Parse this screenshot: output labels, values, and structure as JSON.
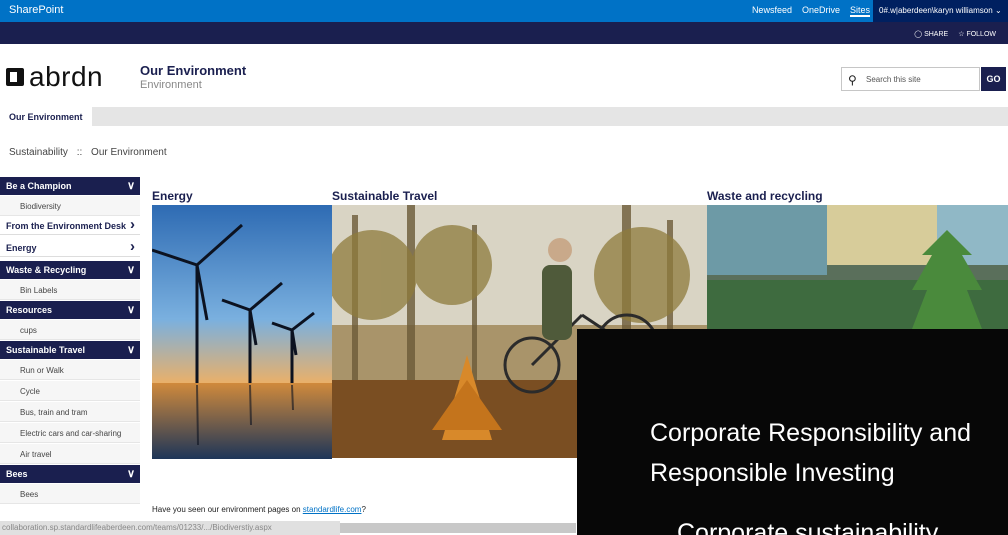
{
  "suite": {
    "brand": "SharePoint",
    "links": [
      "Newsfeed",
      "OneDrive",
      "Sites"
    ],
    "user": "0#.w|aberdeen\\karyn williamson"
  },
  "actions": {
    "share": "SHARE",
    "follow": "FOLLOW"
  },
  "header": {
    "logo_text": "abrdn",
    "site_title": "Our Environment",
    "site_subtitle": "Environment"
  },
  "search": {
    "placeholder": "Search this site",
    "go_label": "GO"
  },
  "topnav": {
    "tab": "Our Environment"
  },
  "breadcrumb": {
    "root": "Sustainability",
    "sep": "::",
    "current": "Our Environment"
  },
  "sidebar": {
    "items": [
      {
        "label": "Be a Champion",
        "type": "head",
        "chevron": "down"
      },
      {
        "label": "Biodiversity",
        "type": "sub"
      },
      {
        "label": "From the Environment Desk",
        "type": "plain",
        "chevron": "right"
      },
      {
        "label": "Energy",
        "type": "plain",
        "chevron": "right"
      },
      {
        "label": "Waste & Recycling",
        "type": "head",
        "chevron": "down"
      },
      {
        "label": "Bin Labels",
        "type": "sub"
      },
      {
        "label": "Resources",
        "type": "head",
        "chevron": "down"
      },
      {
        "label": "cups",
        "type": "sub"
      },
      {
        "label": "Sustainable Travel",
        "type": "head",
        "chevron": "down"
      },
      {
        "label": "Run or Walk",
        "type": "sub"
      },
      {
        "label": "Cycle",
        "type": "sub"
      },
      {
        "label": "Bus, train and tram",
        "type": "sub"
      },
      {
        "label": "Electric cars and car-sharing",
        "type": "sub"
      },
      {
        "label": "Air travel",
        "type": "sub"
      },
      {
        "label": "Bees",
        "type": "head",
        "chevron": "down"
      },
      {
        "label": "Bees",
        "type": "sub"
      }
    ]
  },
  "sections": {
    "energy": "Energy",
    "travel": "Sustainable Travel",
    "waste": "Waste and recycling"
  },
  "promo": {
    "prefix": "Have you seen our environment pages on ",
    "link": "standardlife.com",
    "suffix": "?"
  },
  "status": {
    "url": "collaboration.sp.standardlifeaberdeen.com/teams/01233/.../Biodiverstiy.aspx"
  },
  "overlay": {
    "line1": "Corporate Responsibility and",
    "line2": "Responsible Investing",
    "line3": "Corporate sustainability"
  },
  "colors": {
    "suite": "#0072c6",
    "navy": "#1a1f4f",
    "link": "#0072c6"
  }
}
